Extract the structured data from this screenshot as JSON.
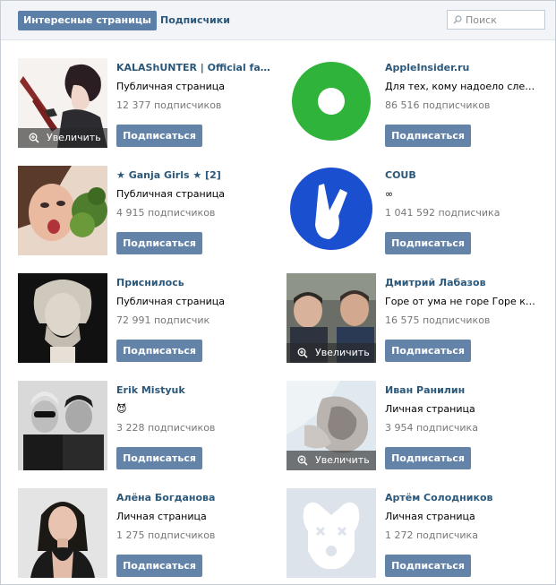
{
  "tabs": {
    "interesting": "Интересные страницы",
    "subscribers": "Подписчики"
  },
  "search": {
    "placeholder": "Поиск"
  },
  "zoom_label": "Увеличить",
  "subscribe_label": "Подписаться",
  "colors": {
    "link": "#2b587a",
    "button": "#6383a8",
    "active_tab": "#5b7fa6",
    "muted": "#777777"
  },
  "items": [
    {
      "name": "KALAShUNTER | Official fan-...",
      "desc": "Публичная страница",
      "count": "12 377 подписчиков"
    },
    {
      "name": "AppleInsider.ru",
      "desc": "Для тех, кому надоело следить ...",
      "count": "86 516 подписчиков"
    },
    {
      "name": "★ Ganja Girls ★ [2]",
      "desc": "Публичная страница",
      "count": "4 915 подписчиков"
    },
    {
      "name": "COUB",
      "desc": "∞",
      "count": "1 041 592 подписчика"
    },
    {
      "name": "Приснилось",
      "desc": "Публичная страница",
      "count": "72 991 подписчик"
    },
    {
      "name": "Дмитрий Лабазов",
      "desc": "Горе от ума не горе Горе когда ...",
      "count": "16 575 подписчиков"
    },
    {
      "name": "Erik Mistyuk",
      "desc": "😈",
      "count": "3 228 подписчиков"
    },
    {
      "name": "Иван Ранилин",
      "desc": "Личная страница",
      "count": "3 954 подписчика"
    },
    {
      "name": "Алёна Богданова",
      "desc": "Личная страница",
      "count": "1 275 подписчиков"
    },
    {
      "name": "Артём Солодников",
      "desc": "Личная страница",
      "count": "1 272 подписчика"
    }
  ]
}
